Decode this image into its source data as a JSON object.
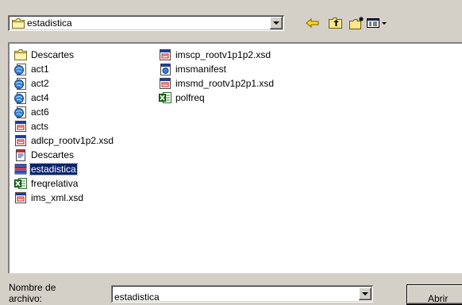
{
  "look_in": {
    "value": "estadistica",
    "icon": "folder-icon"
  },
  "toolbar": {
    "back_icon": "back-arrow-icon",
    "up_icon": "up-folder-icon",
    "new_folder_icon": "new-folder-icon",
    "views_icon": "views-menu-icon"
  },
  "files": [
    {
      "name": "Descartes",
      "icon": "folder-icon"
    },
    {
      "name": "act1",
      "icon": "html-document-icon"
    },
    {
      "name": "act2",
      "icon": "html-document-icon"
    },
    {
      "name": "act4",
      "icon": "html-document-icon"
    },
    {
      "name": "act6",
      "icon": "html-document-icon"
    },
    {
      "name": "acts",
      "icon": "xsd-file-icon"
    },
    {
      "name": "adlcp_rootv1p2.xsd",
      "icon": "xsd-file-icon"
    },
    {
      "name": "Descartes",
      "icon": "text-document-icon"
    },
    {
      "name": "estadistica",
      "icon": "data-file-icon",
      "selected": true
    },
    {
      "name": "freqrelativa",
      "icon": "excel-file-icon"
    },
    {
      "name": "ims_xml.xsd",
      "icon": "xsd-file-icon"
    },
    {
      "name": "imscp_rootv1p1p2.xsd",
      "icon": "xsd-file-icon"
    },
    {
      "name": "imsmanifest",
      "icon": "xml-document-icon"
    },
    {
      "name": "imsmd_rootv1p2p1.xsd",
      "icon": "xsd-file-icon"
    },
    {
      "name": "polfreq",
      "icon": "excel-file-icon"
    }
  ],
  "file_name": {
    "label_line1": "Nombre de",
    "label_line2": "archivo:",
    "value": "estadistica"
  },
  "open_button": {
    "label": "Abrir"
  },
  "colors": {
    "selection": "#0a246a",
    "face": "#d4d0c8"
  }
}
